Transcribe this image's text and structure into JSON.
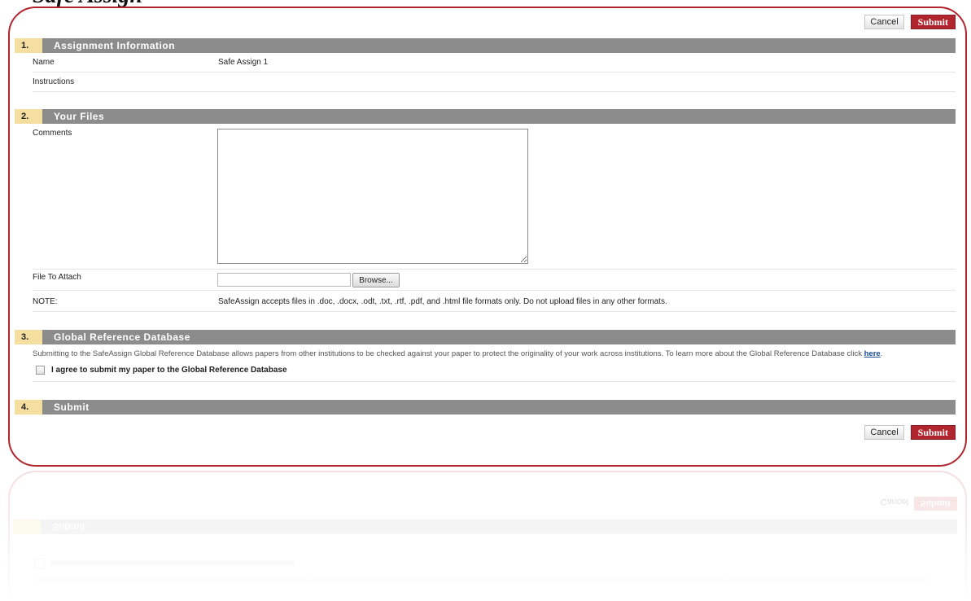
{
  "page_heading": "Safe Assign",
  "buttons": {
    "cancel": "Cancel",
    "submit": "Submit"
  },
  "steps": [
    {
      "num": "1.",
      "title": "Assignment Information"
    },
    {
      "num": "2.",
      "title": "Your Files"
    },
    {
      "num": "3.",
      "title": "Global Reference Database"
    },
    {
      "num": "4.",
      "title": "Submit"
    }
  ],
  "assignment": {
    "name_label": "Name",
    "name_value": "Safe Assign 1",
    "instructions_label": "Instructions"
  },
  "files": {
    "comments_label": "Comments",
    "comments_value": "",
    "file_label": "File To Attach",
    "file_value": "",
    "browse_label": "Browse...",
    "note_label": "NOTE:",
    "note_value": "SafeAssign accepts files in .doc, .docx, .odt, .txt, .rtf, .pdf, and .html file formats only. Do not upload files in any other formats."
  },
  "grd": {
    "description": "Submitting to the SafeAssign Global Reference Database allows papers from other institutions to be checked against your paper to protect the originality of your work across institutions. To learn more about the Global Reference Database click ",
    "link_text": "here",
    "agree_label": "I agree to submit my paper to the Global Reference Database",
    "agree_checked": false
  },
  "colors": {
    "accent": "#b0252e",
    "step_num_bg": "#f5dfa0",
    "step_bar_bg": "#8c8c8c"
  }
}
